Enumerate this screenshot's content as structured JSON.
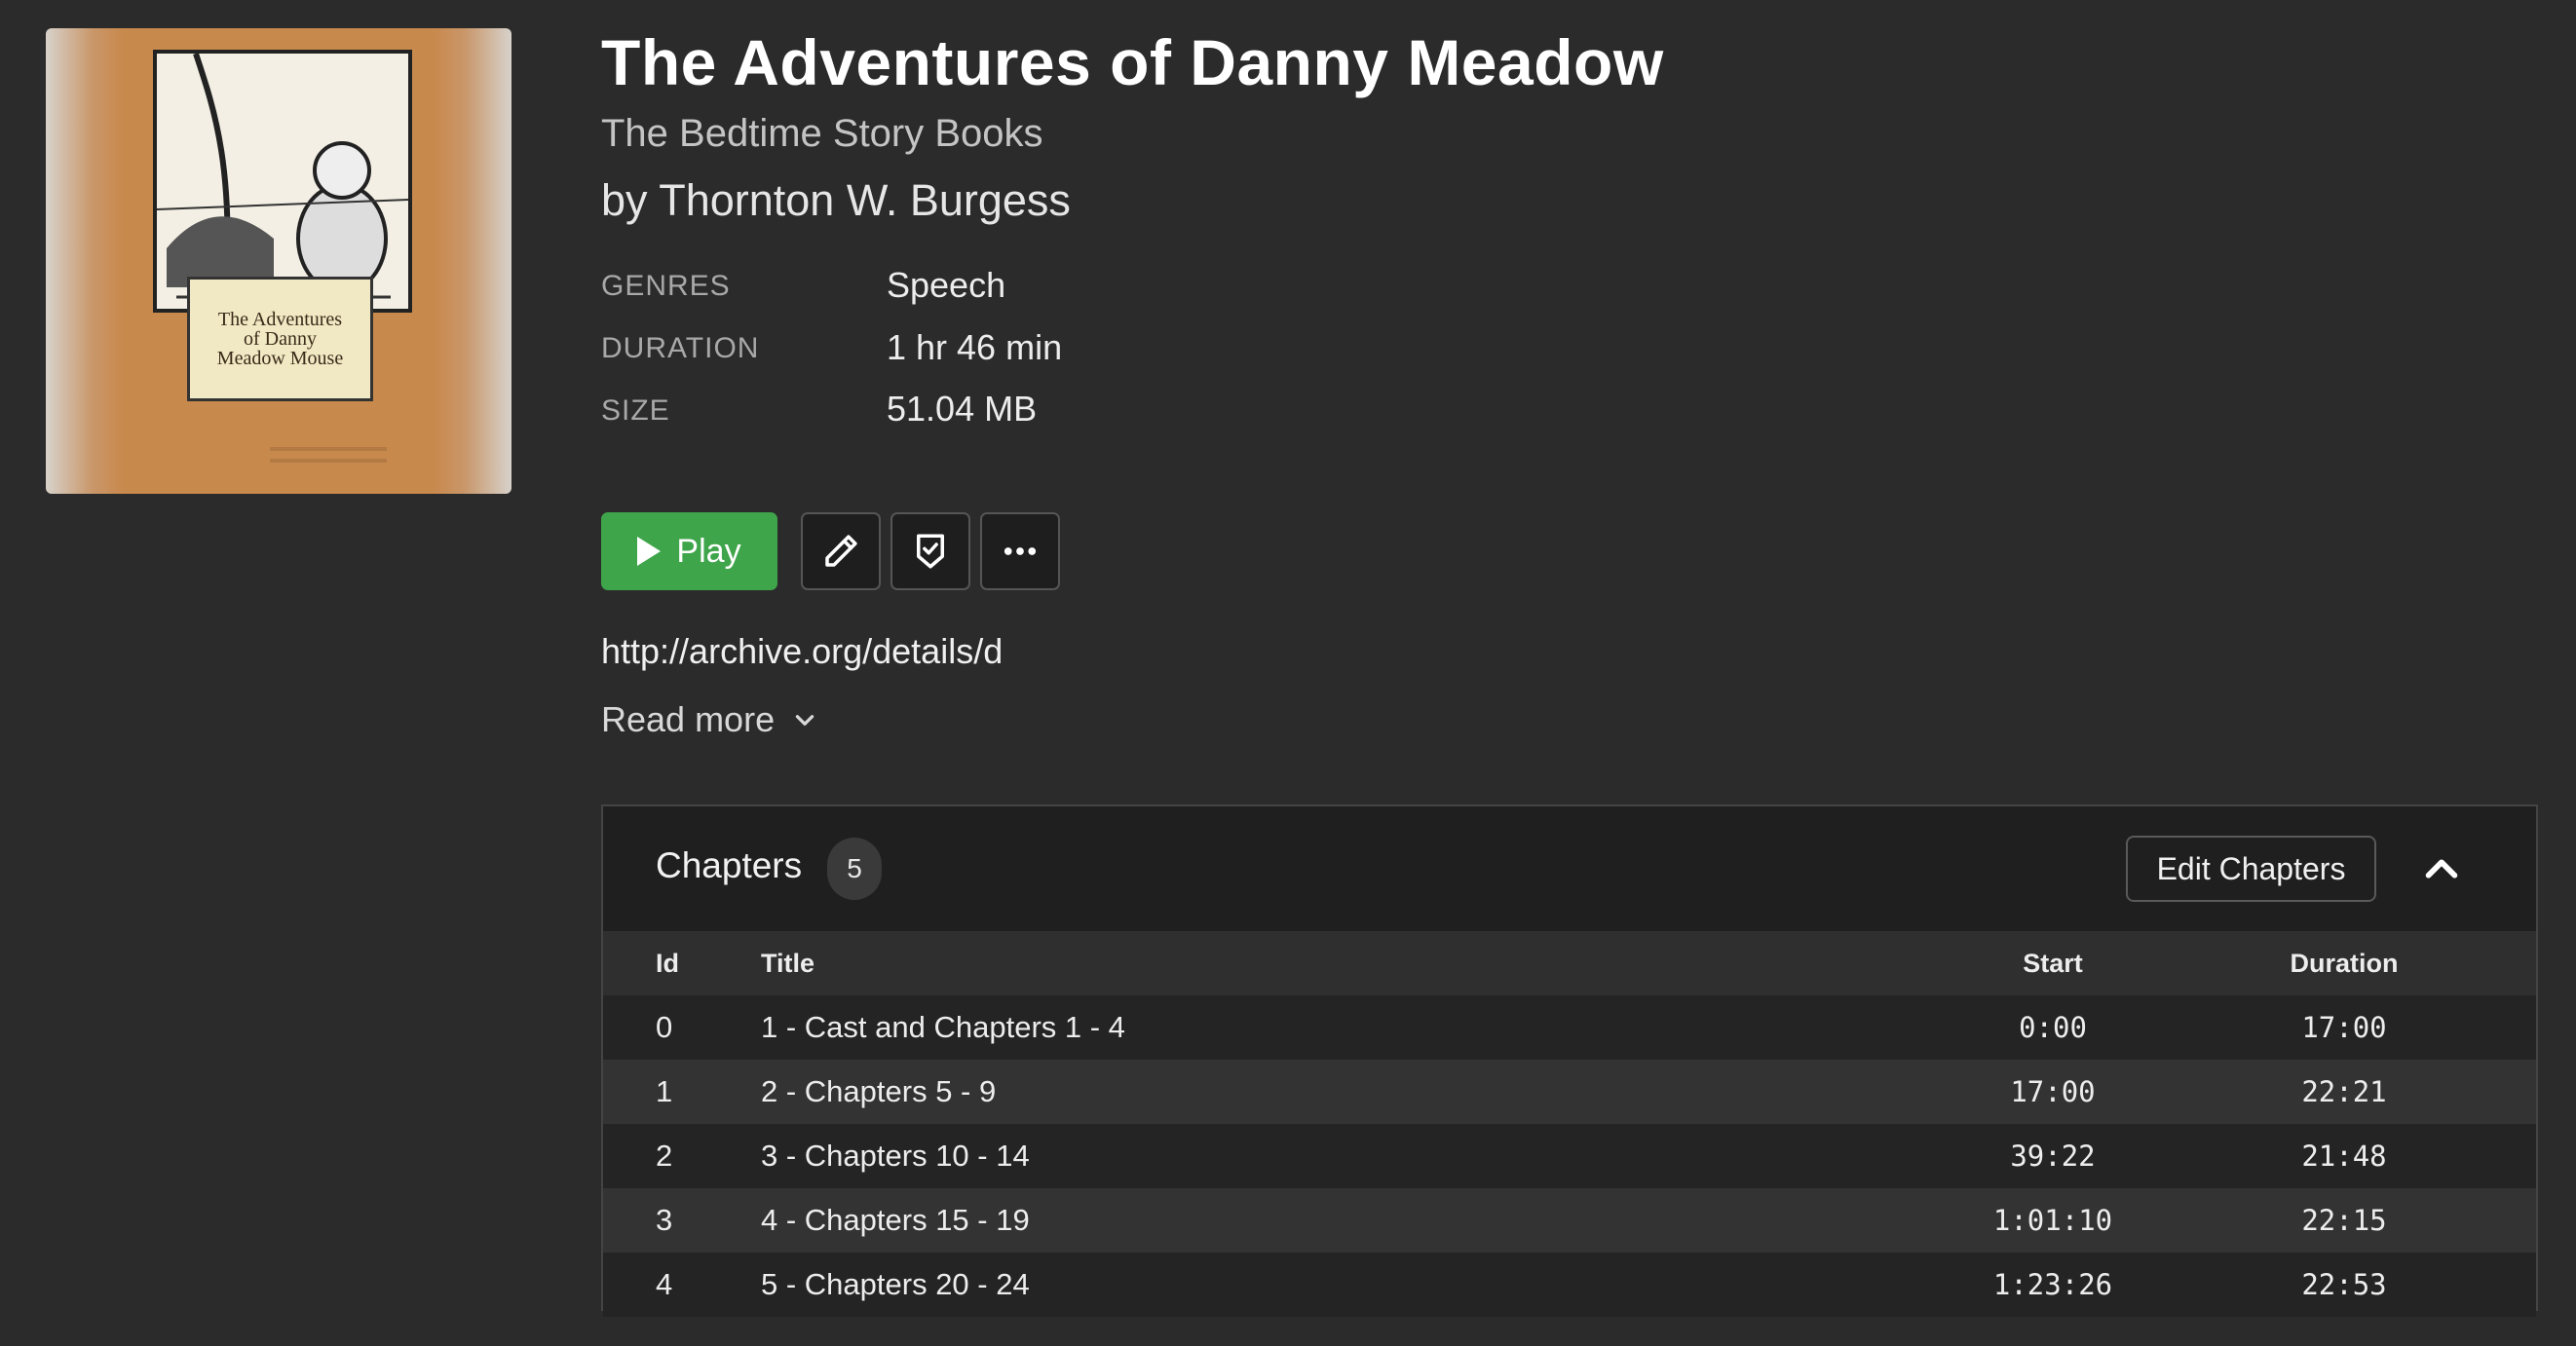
{
  "book": {
    "title": "The Adventures of Danny Meadow",
    "series": "The Bedtime Story Books",
    "author": "by Thornton W. Burgess",
    "cover_text": "The Adventures\nof Danny\nMeadow Mouse"
  },
  "details": [
    {
      "label": "GENRES",
      "value": "Speech"
    },
    {
      "label": "DURATION",
      "value": "1 hr 46 min"
    },
    {
      "label": "SIZE",
      "value": "51.04 MB"
    }
  ],
  "actions": {
    "play_label": "Play",
    "edit_icon": "pencil-icon",
    "mark_icon": "shield-check-icon",
    "more_icon": "ellipsis-icon",
    "play_color": "#3ea54a"
  },
  "description": {
    "text": "http://archive.org/details/d",
    "read_more_label": "Read more"
  },
  "chapters": {
    "heading": "Chapters",
    "count": "5",
    "edit_label": "Edit Chapters",
    "columns": {
      "id": "Id",
      "title": "Title",
      "start": "Start",
      "duration": "Duration"
    },
    "rows": [
      {
        "id": "0",
        "title": "1 - Cast and Chapters 1 - 4",
        "start": "0:00",
        "duration": "17:00"
      },
      {
        "id": "1",
        "title": "2 - Chapters 5 - 9",
        "start": "17:00",
        "duration": "22:21"
      },
      {
        "id": "2",
        "title": "3 - Chapters 10 - 14",
        "start": "39:22",
        "duration": "21:48"
      },
      {
        "id": "3",
        "title": "4 - Chapters 15 - 19",
        "start": "1:01:10",
        "duration": "22:15"
      },
      {
        "id": "4",
        "title": "5 - Chapters 20 - 24",
        "start": "1:23:26",
        "duration": "22:53"
      }
    ]
  }
}
